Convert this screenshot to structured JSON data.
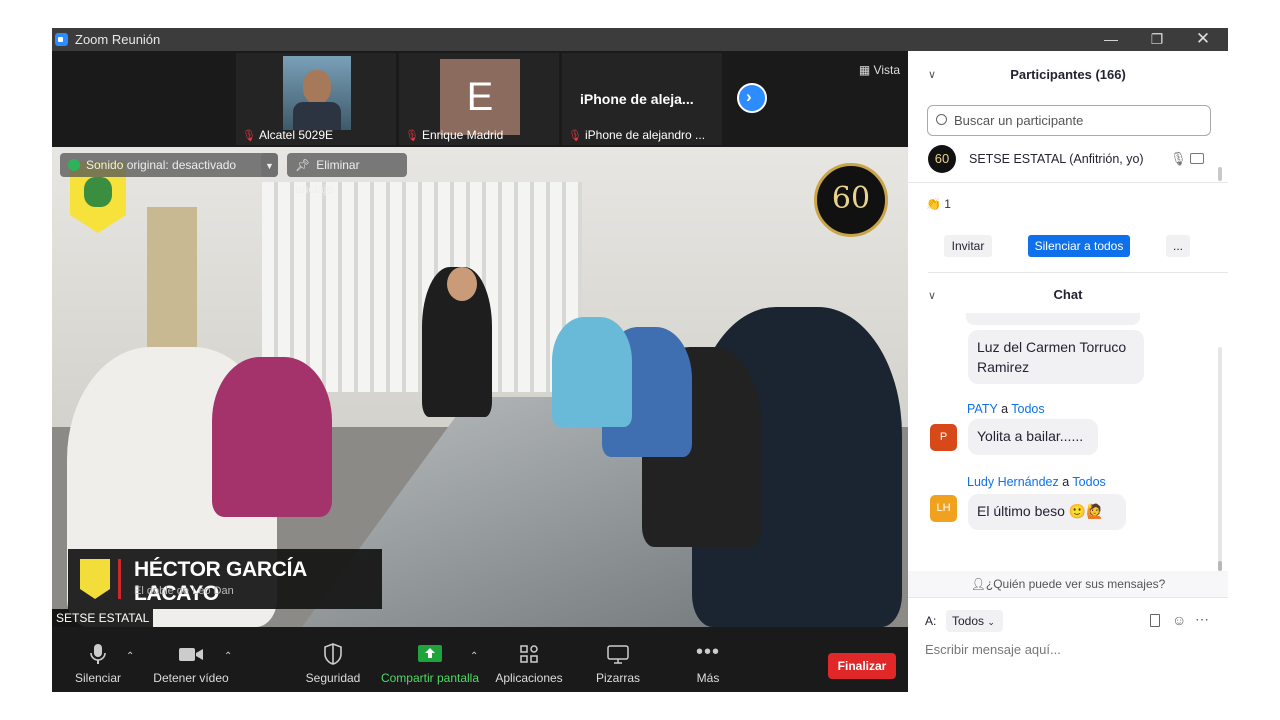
{
  "window": {
    "title": "Zoom Reunión"
  },
  "thumbnails": [
    {
      "name": "Alcatel 5029E",
      "type": "video"
    },
    {
      "name": "Enrique Madrid",
      "type": "initial",
      "initial": "E"
    },
    {
      "name": "iPhone de alejandro ...",
      "type": "title",
      "title": "iPhone de aleja..."
    }
  ],
  "view_label": "Vista",
  "overlay": {
    "original_sound": "Sonido original: desactivado",
    "unpin": "Eliminar anclaje",
    "logo_text": "60"
  },
  "nameplate": {
    "name": "HÉCTOR GARCÍA LACAYO",
    "subtitle": "El doble de Leo Dan"
  },
  "speaker_label": "SETSE ESTATAL",
  "toolbar": {
    "mute": "Silenciar",
    "stop_video": "Detener vídeo",
    "security": "Seguridad",
    "share": "Compartir pantalla",
    "apps": "Aplicaciones",
    "whiteboards": "Pizarras",
    "more": "Más",
    "end": "Finalizar"
  },
  "participants": {
    "header": "Participantes (166)",
    "search_placeholder": "Buscar un participante",
    "host": "SETSE ESTATAL (Anfitrión, yo)",
    "host_avatar": "60",
    "reactions": "1",
    "invite": "Invitar",
    "mute_all": "Silenciar a todos",
    "more": "..."
  },
  "chat": {
    "header": "Chat",
    "messages": [
      {
        "sender": "",
        "to": "",
        "avatar": "",
        "text": "Luz del Carmen Torruco Ramirez"
      },
      {
        "sender": "PATY",
        "to": "Todos",
        "avatar": "P",
        "text": "Yolita a bailar......"
      },
      {
        "sender": "Ludy Hernández",
        "to": "Todos",
        "avatar": "LH",
        "text": "El último beso 🙂🙋"
      }
    ],
    "a_word": "a",
    "who_can_see": "¿Quién puede ver sus mensajes?",
    "to_label": "A:",
    "to_value": "Todos",
    "input_placeholder": "Escribir mensaje aquí..."
  },
  "colors": {
    "accent": "#0e71eb",
    "end": "#e02828",
    "share_green": "#1fa33b"
  }
}
